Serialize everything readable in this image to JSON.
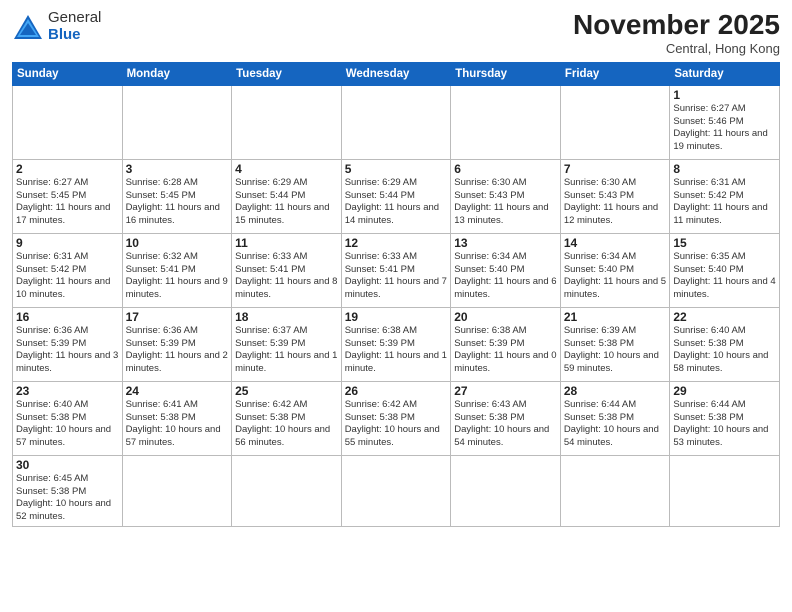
{
  "logo": {
    "general": "General",
    "blue": "Blue"
  },
  "title": "November 2025",
  "subtitle": "Central, Hong Kong",
  "days_of_week": [
    "Sunday",
    "Monday",
    "Tuesday",
    "Wednesday",
    "Thursday",
    "Friday",
    "Saturday"
  ],
  "weeks": [
    [
      {
        "day": "",
        "info": ""
      },
      {
        "day": "",
        "info": ""
      },
      {
        "day": "",
        "info": ""
      },
      {
        "day": "",
        "info": ""
      },
      {
        "day": "",
        "info": ""
      },
      {
        "day": "",
        "info": ""
      },
      {
        "day": "1",
        "info": "Sunrise: 6:27 AM\nSunset: 5:46 PM\nDaylight: 11 hours\nand 19 minutes."
      }
    ],
    [
      {
        "day": "2",
        "info": "Sunrise: 6:27 AM\nSunset: 5:45 PM\nDaylight: 11 hours\nand 17 minutes."
      },
      {
        "day": "3",
        "info": "Sunrise: 6:28 AM\nSunset: 5:45 PM\nDaylight: 11 hours\nand 16 minutes."
      },
      {
        "day": "4",
        "info": "Sunrise: 6:29 AM\nSunset: 5:44 PM\nDaylight: 11 hours\nand 15 minutes."
      },
      {
        "day": "5",
        "info": "Sunrise: 6:29 AM\nSunset: 5:44 PM\nDaylight: 11 hours\nand 14 minutes."
      },
      {
        "day": "6",
        "info": "Sunrise: 6:30 AM\nSunset: 5:43 PM\nDaylight: 11 hours\nand 13 minutes."
      },
      {
        "day": "7",
        "info": "Sunrise: 6:30 AM\nSunset: 5:43 PM\nDaylight: 11 hours\nand 12 minutes."
      },
      {
        "day": "8",
        "info": "Sunrise: 6:31 AM\nSunset: 5:42 PM\nDaylight: 11 hours\nand 11 minutes."
      }
    ],
    [
      {
        "day": "9",
        "info": "Sunrise: 6:31 AM\nSunset: 5:42 PM\nDaylight: 11 hours\nand 10 minutes."
      },
      {
        "day": "10",
        "info": "Sunrise: 6:32 AM\nSunset: 5:41 PM\nDaylight: 11 hours\nand 9 minutes."
      },
      {
        "day": "11",
        "info": "Sunrise: 6:33 AM\nSunset: 5:41 PM\nDaylight: 11 hours\nand 8 minutes."
      },
      {
        "day": "12",
        "info": "Sunrise: 6:33 AM\nSunset: 5:41 PM\nDaylight: 11 hours\nand 7 minutes."
      },
      {
        "day": "13",
        "info": "Sunrise: 6:34 AM\nSunset: 5:40 PM\nDaylight: 11 hours\nand 6 minutes."
      },
      {
        "day": "14",
        "info": "Sunrise: 6:34 AM\nSunset: 5:40 PM\nDaylight: 11 hours\nand 5 minutes."
      },
      {
        "day": "15",
        "info": "Sunrise: 6:35 AM\nSunset: 5:40 PM\nDaylight: 11 hours\nand 4 minutes."
      }
    ],
    [
      {
        "day": "16",
        "info": "Sunrise: 6:36 AM\nSunset: 5:39 PM\nDaylight: 11 hours\nand 3 minutes."
      },
      {
        "day": "17",
        "info": "Sunrise: 6:36 AM\nSunset: 5:39 PM\nDaylight: 11 hours\nand 2 minutes."
      },
      {
        "day": "18",
        "info": "Sunrise: 6:37 AM\nSunset: 5:39 PM\nDaylight: 11 hours\nand 1 minute."
      },
      {
        "day": "19",
        "info": "Sunrise: 6:38 AM\nSunset: 5:39 PM\nDaylight: 11 hours\nand 1 minute."
      },
      {
        "day": "20",
        "info": "Sunrise: 6:38 AM\nSunset: 5:39 PM\nDaylight: 11 hours\nand 0 minutes."
      },
      {
        "day": "21",
        "info": "Sunrise: 6:39 AM\nSunset: 5:38 PM\nDaylight: 10 hours\nand 59 minutes."
      },
      {
        "day": "22",
        "info": "Sunrise: 6:40 AM\nSunset: 5:38 PM\nDaylight: 10 hours\nand 58 minutes."
      }
    ],
    [
      {
        "day": "23",
        "info": "Sunrise: 6:40 AM\nSunset: 5:38 PM\nDaylight: 10 hours\nand 57 minutes."
      },
      {
        "day": "24",
        "info": "Sunrise: 6:41 AM\nSunset: 5:38 PM\nDaylight: 10 hours\nand 57 minutes."
      },
      {
        "day": "25",
        "info": "Sunrise: 6:42 AM\nSunset: 5:38 PM\nDaylight: 10 hours\nand 56 minutes."
      },
      {
        "day": "26",
        "info": "Sunrise: 6:42 AM\nSunset: 5:38 PM\nDaylight: 10 hours\nand 55 minutes."
      },
      {
        "day": "27",
        "info": "Sunrise: 6:43 AM\nSunset: 5:38 PM\nDaylight: 10 hours\nand 54 minutes."
      },
      {
        "day": "28",
        "info": "Sunrise: 6:44 AM\nSunset: 5:38 PM\nDaylight: 10 hours\nand 54 minutes."
      },
      {
        "day": "29",
        "info": "Sunrise: 6:44 AM\nSunset: 5:38 PM\nDaylight: 10 hours\nand 53 minutes."
      }
    ],
    [
      {
        "day": "30",
        "info": "Sunrise: 6:45 AM\nSunset: 5:38 PM\nDaylight: 10 hours\nand 52 minutes."
      },
      {
        "day": "",
        "info": ""
      },
      {
        "day": "",
        "info": ""
      },
      {
        "day": "",
        "info": ""
      },
      {
        "day": "",
        "info": ""
      },
      {
        "day": "",
        "info": ""
      },
      {
        "day": "",
        "info": ""
      }
    ]
  ]
}
